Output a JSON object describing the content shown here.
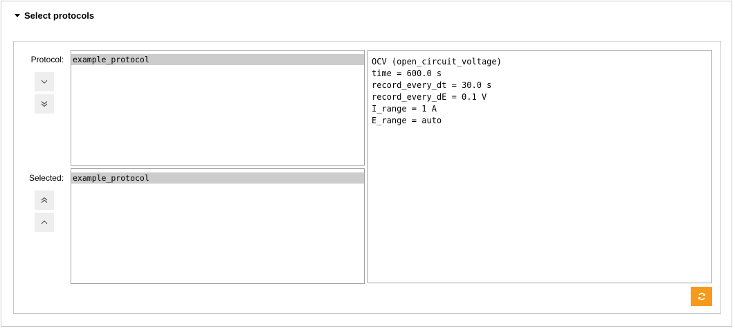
{
  "section": {
    "title": "Select protocols"
  },
  "protocol": {
    "label": "Protocol:",
    "items": [
      "example_protocol"
    ]
  },
  "selected": {
    "label": "Selected:",
    "items": [
      "example_protocol"
    ]
  },
  "details": {
    "lines": [
      "OCV (open_circuit_voltage)",
      "time = 600.0 s",
      "record_every_dt = 30.0 s",
      "record_every_dE = 0.1 V",
      "I_range = 1 A",
      "E_range = auto"
    ]
  },
  "icons": {
    "move_down": "chevron-down-icon",
    "move_bottom": "double-chevron-down-icon",
    "move_top": "double-chevron-up-icon",
    "move_up": "chevron-up-icon",
    "refresh": "refresh-icon"
  },
  "colors": {
    "accent": "#f79a1b",
    "selection": "#cccccc",
    "button_bg": "#eeeeee"
  }
}
